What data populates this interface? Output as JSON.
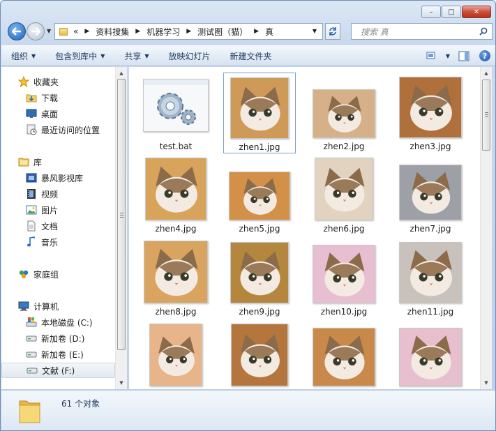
{
  "window": {
    "caption_buttons": {
      "minimize": "–",
      "maximize": "□",
      "close": "✕"
    }
  },
  "address_bar": {
    "overflow": "«",
    "segments": [
      "资料搜集",
      "机器学习",
      "测试图（猫）",
      "真"
    ]
  },
  "search": {
    "placeholder": "搜索 真"
  },
  "toolbar": {
    "items": [
      {
        "label": "组织",
        "dropdown": true
      },
      {
        "label": "包含到库中",
        "dropdown": true
      },
      {
        "label": "共享",
        "dropdown": true
      },
      {
        "label": "放映幻灯片",
        "dropdown": false
      },
      {
        "label": "新建文件夹",
        "dropdown": false
      }
    ],
    "help": "?"
  },
  "sidebar": {
    "items": [
      {
        "label": "收藏夹",
        "icon": "star-icon",
        "indent": 0
      },
      {
        "label": "下载",
        "icon": "download-folder-icon",
        "indent": 1
      },
      {
        "label": "桌面",
        "icon": "desktop-icon",
        "indent": 1
      },
      {
        "label": "最近访问的位置",
        "icon": "recent-places-icon",
        "indent": 1
      },
      {
        "label": "库",
        "icon": "library-icon",
        "indent": 0
      },
      {
        "label": "暴风影视库",
        "icon": "video-library-icon",
        "indent": 1
      },
      {
        "label": "视频",
        "icon": "video-icon",
        "indent": 1
      },
      {
        "label": "图片",
        "icon": "pictures-icon",
        "indent": 1
      },
      {
        "label": "文档",
        "icon": "documents-icon",
        "indent": 1
      },
      {
        "label": "音乐",
        "icon": "music-icon",
        "indent": 1
      },
      {
        "label": "家庭组",
        "icon": "homegroup-icon",
        "indent": 0
      },
      {
        "label": "计算机",
        "icon": "computer-icon",
        "indent": 0
      },
      {
        "label": "本地磁盘 (C:)",
        "icon": "system-drive-icon",
        "indent": 1
      },
      {
        "label": "新加卷 (D:)",
        "icon": "drive-icon",
        "indent": 1
      },
      {
        "label": "新加卷 (E:)",
        "icon": "drive-icon",
        "indent": 1
      },
      {
        "label": "文献 (F:)",
        "icon": "drive-icon",
        "indent": 1,
        "selected": true
      }
    ]
  },
  "files": [
    {
      "name": "test.bat",
      "icon": "batch-file-gears-icon",
      "selected": false
    },
    {
      "name": "zhen1.jpg",
      "icon": "cat-photo-icon",
      "selected": true
    },
    {
      "name": "zhen2.jpg",
      "icon": "cat-photo-icon"
    },
    {
      "name": "zhen3.jpg",
      "icon": "cat-photo-icon"
    },
    {
      "name": "zhen4.jpg",
      "icon": "cat-photo-icon"
    },
    {
      "name": "zhen5.jpg",
      "icon": "cat-photo-icon"
    },
    {
      "name": "zhen6.jpg",
      "icon": "cat-photo-icon"
    },
    {
      "name": "zhen7.jpg",
      "icon": "cat-photo-icon"
    },
    {
      "name": "zhen8.jpg",
      "icon": "cat-photo-icon"
    },
    {
      "name": "zhen9.jpg",
      "icon": "cat-photo-icon"
    },
    {
      "name": "zhen10.jpg",
      "icon": "cat-photo-icon"
    },
    {
      "name": "zhen11.jpg",
      "icon": "cat-photo-icon"
    },
    {
      "name": "",
      "icon": "cat-photo-icon"
    },
    {
      "name": "",
      "icon": "cat-photo-icon"
    },
    {
      "name": "",
      "icon": "cat-photo-icon"
    },
    {
      "name": "",
      "icon": "cat-photo-icon"
    }
  ],
  "status": {
    "text": "61 个对象"
  },
  "colors": {
    "accent": "#2a62b6",
    "selection_border": "#7da2ce",
    "toolbar_text": "#1e395b"
  }
}
